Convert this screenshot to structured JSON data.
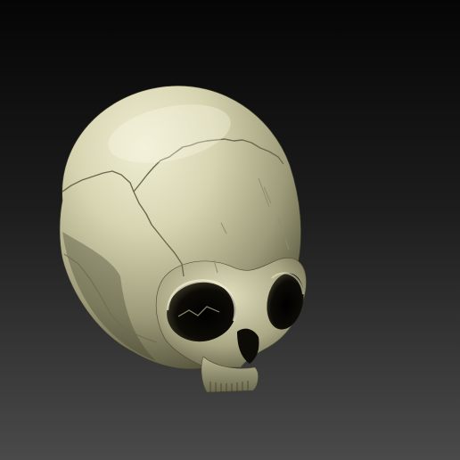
{
  "viewport": {
    "background_top": "#050505",
    "background_bottom": "#4a4a4a",
    "frame_line_color": "#8a8a8a"
  },
  "model": {
    "subject": "skull-sculpt",
    "material_base": "#d4d2ae",
    "material_highlight": "#f0eed4",
    "material_shadow": "#3a3826",
    "cavity_color": "#0c0b06"
  }
}
